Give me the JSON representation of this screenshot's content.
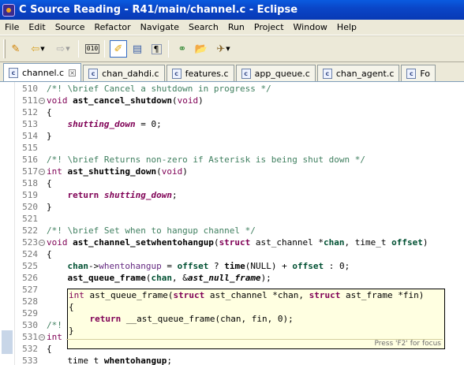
{
  "window": {
    "title": "C Source Reading - R41/main/channel.c - Eclipse"
  },
  "menu": [
    "File",
    "Edit",
    "Source",
    "Refactor",
    "Navigate",
    "Search",
    "Run",
    "Project",
    "Window",
    "Help"
  ],
  "tabs": [
    {
      "label": "channel.c",
      "active": true
    },
    {
      "label": "chan_dahdi.c",
      "active": false
    },
    {
      "label": "features.c",
      "active": false
    },
    {
      "label": "app_queue.c",
      "active": false
    },
    {
      "label": "chan_agent.c",
      "active": false
    },
    {
      "label": "Fo",
      "active": false
    }
  ],
  "file_icon_letter": "c",
  "editor": {
    "lines": [
      {
        "n": "510",
        "fold": false,
        "tokens": [
          [
            "cm",
            "/*! \\brief Cancel a shutdown in progress */"
          ]
        ]
      },
      {
        "n": "511",
        "fold": true,
        "tokens": [
          [
            "kwp",
            "void "
          ],
          [
            "fn",
            "ast_cancel_shutdown"
          ],
          [
            "",
            "("
          ],
          [
            "kwp",
            "void"
          ],
          [
            "",
            ")"
          ]
        ]
      },
      {
        "n": "512",
        "fold": false,
        "tokens": [
          [
            "",
            "{"
          ]
        ]
      },
      {
        "n": "513",
        "fold": false,
        "tokens": [
          [
            "",
            "    "
          ],
          [
            "gv",
            "shutting_down"
          ],
          [
            "",
            " = 0;"
          ]
        ]
      },
      {
        "n": "514",
        "fold": false,
        "tokens": [
          [
            "",
            "}"
          ]
        ]
      },
      {
        "n": "515",
        "fold": false,
        "tokens": []
      },
      {
        "n": "516",
        "fold": false,
        "tokens": [
          [
            "cm",
            "/*! \\brief Returns non-zero if Asterisk is being shut down */"
          ]
        ]
      },
      {
        "n": "517",
        "fold": true,
        "tokens": [
          [
            "kwp",
            "int "
          ],
          [
            "fn",
            "ast_shutting_down"
          ],
          [
            "",
            "("
          ],
          [
            "kwp",
            "void"
          ],
          [
            "",
            ")"
          ]
        ]
      },
      {
        "n": "518",
        "fold": false,
        "tokens": [
          [
            "",
            "{"
          ]
        ]
      },
      {
        "n": "519",
        "fold": false,
        "tokens": [
          [
            "",
            "    "
          ],
          [
            "kw",
            "return "
          ],
          [
            "gv",
            "shutting_down"
          ],
          [
            "",
            ";"
          ]
        ]
      },
      {
        "n": "520",
        "fold": false,
        "tokens": [
          [
            "",
            "}"
          ]
        ]
      },
      {
        "n": "521",
        "fold": false,
        "tokens": []
      },
      {
        "n": "522",
        "fold": false,
        "tokens": [
          [
            "cm",
            "/*! \\brief Set when to hangup channel */"
          ]
        ]
      },
      {
        "n": "523",
        "fold": true,
        "tokens": [
          [
            "kwp",
            "void "
          ],
          [
            "fn",
            "ast_channel_setwhentohangup"
          ],
          [
            "",
            "("
          ],
          [
            "kw",
            "struct"
          ],
          [
            "",
            " ast_channel *"
          ],
          [
            "pm",
            "chan"
          ],
          [
            "",
            ", time_t "
          ],
          [
            "pm",
            "offset"
          ],
          [
            "",
            ")"
          ]
        ]
      },
      {
        "n": "524",
        "fold": false,
        "tokens": [
          [
            "",
            "{"
          ]
        ]
      },
      {
        "n": "525",
        "fold": false,
        "tokens": [
          [
            "",
            "    "
          ],
          [
            "pm",
            "chan"
          ],
          [
            "",
            "->"
          ],
          [
            "mc",
            "whentohangup"
          ],
          [
            "",
            " = "
          ],
          [
            "pm",
            "offset"
          ],
          [
            "",
            " ? "
          ],
          [
            "fn",
            "time"
          ],
          [
            "",
            "(NULL) + "
          ],
          [
            "pm",
            "offset"
          ],
          [
            "",
            " : 0;"
          ]
        ]
      },
      {
        "n": "526",
        "fold": false,
        "tokens": [
          [
            "",
            "    "
          ],
          [
            "fn",
            "ast_queue_frame"
          ],
          [
            "",
            "("
          ],
          [
            "pm",
            "chan"
          ],
          [
            "",
            ", &"
          ],
          [
            "it",
            "ast_null_frame"
          ],
          [
            "",
            ");"
          ]
        ]
      },
      {
        "n": "527",
        "fold": false,
        "tokens": []
      },
      {
        "n": "528",
        "fold": false,
        "tokens": []
      },
      {
        "n": "529",
        "fold": false,
        "tokens": []
      },
      {
        "n": "530",
        "fold": false,
        "tokens": [
          [
            "cm",
            "/*!"
          ]
        ]
      },
      {
        "n": "531",
        "fold": true,
        "tokens": [
          [
            "kwp",
            "int"
          ]
        ]
      },
      {
        "n": "532",
        "fold": false,
        "tokens": [
          [
            "",
            "{"
          ]
        ]
      },
      {
        "n": "533",
        "fold": false,
        "tokens": [
          [
            "",
            "    time_t "
          ],
          [
            "fn",
            "whentohangup"
          ],
          [
            "",
            ";"
          ]
        ]
      }
    ],
    "hover": {
      "lines": [
        [
          [
            "kwp",
            "int "
          ],
          [
            "",
            "ast_queue_frame("
          ],
          [
            "kw",
            "struct"
          ],
          [
            "",
            " ast_channel *chan, "
          ],
          [
            "kw",
            "struct"
          ],
          [
            "",
            " ast_frame *fin)"
          ]
        ],
        [
          [
            "",
            "{"
          ]
        ],
        [
          [
            "",
            "    "
          ],
          [
            "kw",
            "return "
          ],
          [
            "",
            "__ast_queue_frame(chan, fin, 0);"
          ]
        ],
        [
          [
            "",
            "}"
          ]
        ]
      ],
      "hint": "Press 'F2' for focus"
    }
  },
  "toolbar_icons": [
    "new-wizard-icon",
    "back-icon",
    "forward-icon",
    "binary-icon",
    "mark-occurrences-icon",
    "outline-toggle-icon",
    "whitespace-icon",
    "open-type-icon",
    "open-folder-icon",
    "run-external-icon"
  ]
}
